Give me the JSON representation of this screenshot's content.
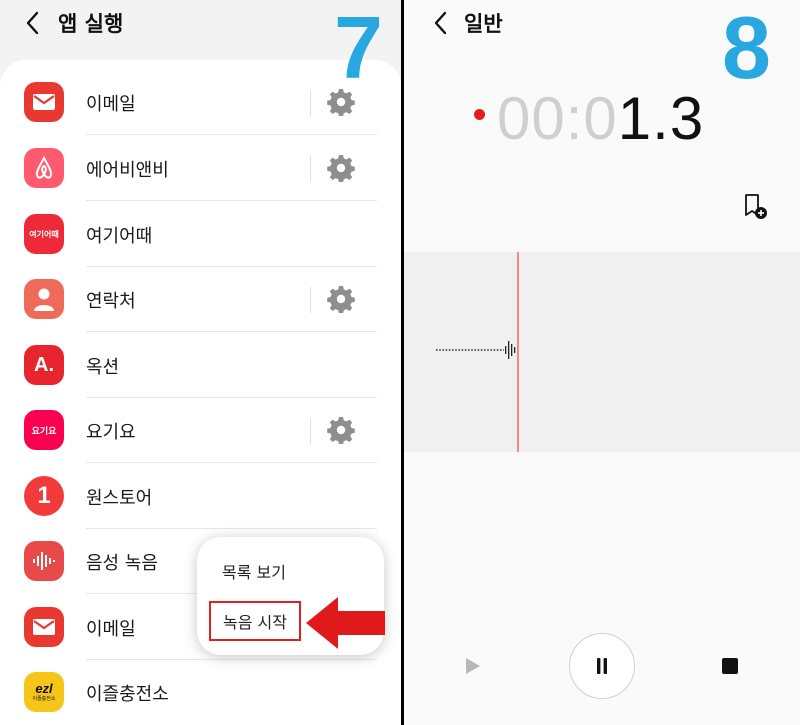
{
  "left_screen": {
    "step_number": "7",
    "header": {
      "back_icon": "chevron-left-icon",
      "title": "앱 실행"
    },
    "apps": [
      {
        "label": "이메일",
        "icon": "email-icon",
        "icon_color": "#e8382f",
        "has_settings": true
      },
      {
        "label": "에어비앤비",
        "icon": "airbnb-icon",
        "icon_color": "#ff5a6e",
        "has_settings": true
      },
      {
        "label": "여기어때",
        "icon": "yeogi-icon",
        "icon_color": "#ee2a3a",
        "icon_text": "여기어때",
        "has_settings": false
      },
      {
        "label": "연락처",
        "icon": "contacts-icon",
        "icon_color": "#f06a5a",
        "has_settings": true
      },
      {
        "label": "옥션",
        "icon": "auction-icon",
        "icon_color": "#e8252f",
        "icon_text": "A.",
        "has_settings": false
      },
      {
        "label": "요기요",
        "icon": "yogiyo-icon",
        "icon_color": "#fa0050",
        "icon_text": "요기요",
        "has_settings": true
      },
      {
        "label": "원스토어",
        "icon": "onestore-icon",
        "icon_color": "#f23a3a",
        "icon_text": "1",
        "has_settings": false
      },
      {
        "label": "음성 녹음",
        "icon": "voice-recorder-icon",
        "icon_color": "#e84a4a",
        "has_settings": true
      },
      {
        "label": "이메일",
        "icon": "email-icon",
        "icon_color": "#e8382f",
        "has_settings": false
      },
      {
        "label": "이즐충전소",
        "icon": "ezl-icon",
        "icon_color": "#f5c518",
        "icon_text": "ezl",
        "icon_subtext": "이즐충전소",
        "has_settings": false
      }
    ],
    "popup_menu": {
      "item1": "목록 보기",
      "item2": "녹음 시작"
    }
  },
  "right_screen": {
    "step_number": "8",
    "header": {
      "back_icon": "chevron-left-icon",
      "title": "일반"
    },
    "timer": {
      "dim_part": "00:0",
      "live_part": "1.3"
    },
    "recording_indicator_color": "#e01e1e",
    "controls": {
      "play": "play-icon",
      "pause": "pause-icon",
      "stop": "stop-icon"
    }
  }
}
